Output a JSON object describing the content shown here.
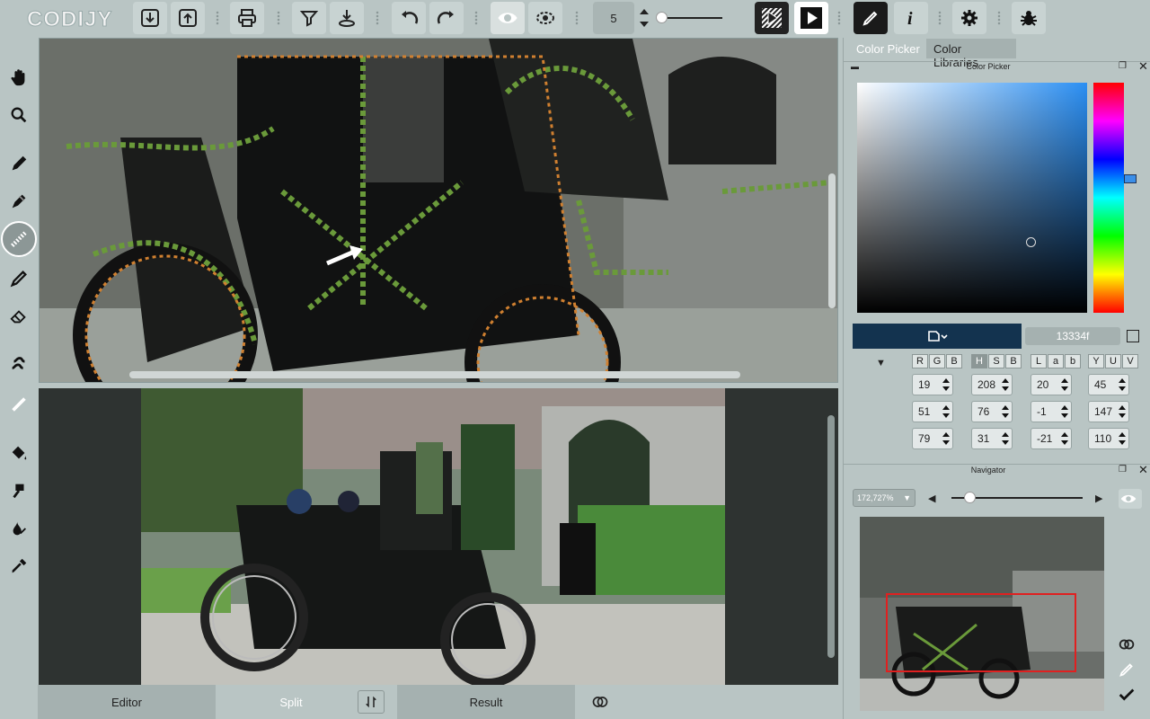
{
  "app": {
    "logo_text": "CODIJY"
  },
  "toolbar": {
    "brush_size": "5",
    "brush_slider_fraction": 0.0
  },
  "right_panel": {
    "tabs": [
      "Color Picker",
      "Color Libraries"
    ],
    "color_picker_title": "Color Picker",
    "hex_value": "13334f",
    "current_color": "#13334f",
    "rgb": {
      "label": [
        "R",
        "G",
        "B"
      ],
      "values": [
        "19",
        "51",
        "79"
      ]
    },
    "hsb": {
      "label": [
        "H",
        "S",
        "B"
      ],
      "values": [
        "208",
        "76",
        "31"
      ]
    },
    "lab": {
      "label": [
        "L",
        "a",
        "b"
      ],
      "values": [
        "20",
        "-1",
        "-21"
      ]
    },
    "yuv": {
      "label": [
        "Y",
        "U",
        "V"
      ],
      "values": [
        "45",
        "147",
        "110"
      ]
    },
    "navigator_title": "Navigator",
    "zoom": "172,727%",
    "hue_marker_fraction": 0.42
  },
  "bottom": {
    "editor": "Editor",
    "split": "Split",
    "result": "Result"
  },
  "colors": {
    "accent": "#13334f",
    "panel_bg": "#b9c5c4",
    "stroke_green": "#6a9a3a",
    "stroke_orange": "#d08030"
  },
  "icons": [
    "download-icon",
    "upload-icon",
    "print-icon",
    "hand-icon",
    "zoom-icon",
    "eye-icon",
    "settings-icon",
    "bug-icon",
    "info-icon",
    "play-icon"
  ]
}
